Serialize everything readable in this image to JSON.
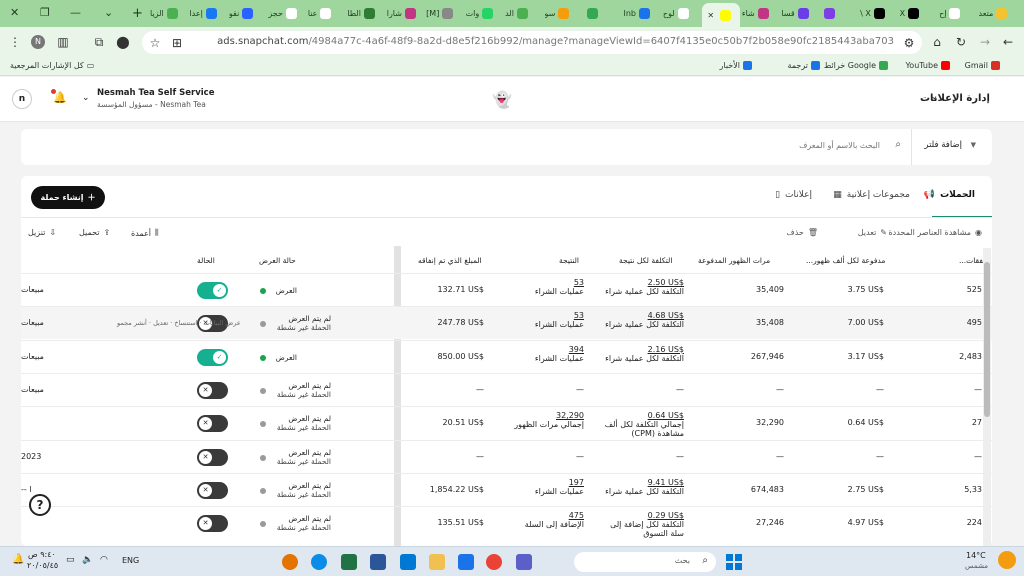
{
  "browser": {
    "tabs": [
      {
        "label": "متعد",
        "color": "#f4c430"
      },
      {
        "label": "إح",
        "color": "#ffffff"
      },
      {
        "label": "X",
        "color": "#000000"
      },
      {
        "label": "\\ X",
        "color": "#000000"
      },
      {
        "label": "",
        "color": "#7b3fe4"
      },
      {
        "label": "قسا",
        "color": "#6a3de8"
      },
      {
        "label": "شاء",
        "color": "#c13584"
      },
      {
        "label": "",
        "color": "#fffc00"
      },
      {
        "label": "لوح",
        "color": "#ffffff"
      },
      {
        "label": "Inb",
        "color": "#1a73e8"
      },
      {
        "label": "",
        "color": "#34a853"
      },
      {
        "label": "سو",
        "color": "#f59e0b"
      },
      {
        "label": "الد",
        "color": "#4caf50"
      },
      {
        "label": "وات",
        "color": "#25d366"
      },
      {
        "label": "[M]",
        "color": "#888888"
      },
      {
        "label": "شارا",
        "color": "#c13584"
      },
      {
        "label": "الطا",
        "color": "#2e7d32"
      },
      {
        "label": "عنا",
        "color": "#ffffff"
      },
      {
        "label": "حجز",
        "color": "#ffffff"
      },
      {
        "label": "نقو",
        "color": "#2962ff"
      },
      {
        "label": "إعدا",
        "color": "#1877f2"
      },
      {
        "label": "الزيا",
        "color": "#4caf50"
      }
    ],
    "url_host": "ads.snapchat.com",
    "url_path": "/4984a77c-4a6f-48f9-8a2d-d8e5f216b992/manage?manageViewId=6407f4135e0c50b7f2b058e90fc2185443aba703",
    "profile_initial": "N",
    "bookmarks": [
      {
        "label": "Gmail",
        "color": "#d93025"
      },
      {
        "label": "YouTube",
        "color": "#ff0000"
      },
      {
        "label": "خرائط Google",
        "color": "#34a853"
      },
      {
        "label": "ترجمة",
        "color": "#1a73e8"
      },
      {
        "label": "الأخبار",
        "color": "#1a73e8"
      }
    ],
    "all_bookmarks": "كل الإشارات المرجعية"
  },
  "app": {
    "title": "إدارة الإعلانات",
    "account_name": "Nesmah Tea Self Service",
    "account_role": "مسؤول المؤسسة - Nesmah Tea",
    "user_initial": "n"
  },
  "filter": {
    "add_filter": "إضافة فلتر",
    "search_placeholder": "البحث بالاسم أو المعرف"
  },
  "tabs": {
    "campaigns": "الحملات",
    "ad_groups": "مجموعات إعلانية",
    "ads": "إعلانات"
  },
  "create_campaign": "إنشاء حملة",
  "toolbar": {
    "view_selected": "مشاهدة العناصر المحددة",
    "edit": "تعديل",
    "delete": "حذف",
    "columns": "أعمدة",
    "upload": "تحميل",
    "download": "تنزيل"
  },
  "columns": {
    "spend_type": "...نفقات",
    "cpm": "...مدفوعة لكل ألف ظهور",
    "paid_impressions": "مرات الظهور المدفوعة",
    "cost_per_result": "التكلفة لكل نتيجة",
    "result": "النتيجة",
    "amount_spent": "المبلغ الذي تم إنفاقه",
    "delivery_status": "حالة العرض",
    "status": "الحالة"
  },
  "row_actions": {
    "view_data": "عرض البيانات",
    "duplicate": "استنساخ",
    "edit": "تعديل",
    "more": "أنشر مجمو"
  },
  "rows": [
    {
      "name": "مبيعات",
      "spend": "525",
      "cpm": "3.75 US$",
      "impressions": "35,409",
      "cpr_value": "2.50 US$",
      "cpr_label": "التكلفة لكل عملية شراء",
      "cpr_label2": "",
      "result_value": "53",
      "result_label": "عمليات الشراء",
      "amount": "132.71 US$",
      "delivery_1": "العرض",
      "delivery_2": "",
      "delivery_color": "#1aa34a",
      "on": true
    },
    {
      "name": "مبيعات",
      "spend": "495",
      "cpm": "7.00 US$",
      "impressions": "35,408",
      "cpr_value": "4.68 US$",
      "cpr_label": "التكلفة لكل عملية شراء",
      "cpr_label2": "",
      "result_value": "53",
      "result_label": "عمليات الشراء",
      "amount": "247.78 US$",
      "delivery_1": "لم يتم العرض",
      "delivery_2": "الحملة غير نشطة",
      "delivery_color": "#9a9a9a",
      "on": false
    },
    {
      "name": "مبيعات",
      "spend": "2,483",
      "cpm": "3.17 US$",
      "impressions": "267,946",
      "cpr_value": "2.16 US$",
      "cpr_label": "التكلفة لكل عملية شراء",
      "cpr_label2": "",
      "result_value": "394",
      "result_label": "عمليات الشراء",
      "amount": "850.00 US$",
      "delivery_1": "العرض",
      "delivery_2": "",
      "delivery_color": "#1aa34a",
      "on": true
    },
    {
      "name": "مبيعات",
      "spend": "—",
      "cpm": "—",
      "impressions": "—",
      "cpr_value": "—",
      "cpr_label": "",
      "cpr_label2": "",
      "result_value": "—",
      "result_label": "",
      "amount": "—",
      "delivery_1": "لم يتم العرض",
      "delivery_2": "الحملة غير نشطة",
      "delivery_color": "#9a9a9a",
      "on": false
    },
    {
      "name": "",
      "spend": "27",
      "cpm": "0.64 US$",
      "impressions": "32,290",
      "cpr_value": "0.64 US$",
      "cpr_label": "إجمالي التكلفة لكل ألف",
      "cpr_label2": "(CPM) مشاهدة",
      "result_value": "32,290",
      "result_label": "إجمالي مرات الظهور",
      "amount": "20.51 US$",
      "delivery_1": "لم يتم العرض",
      "delivery_2": "الحملة غير نشطة",
      "delivery_color": "#9a9a9a",
      "on": false
    },
    {
      "name": "2023",
      "spend": "—",
      "cpm": "—",
      "impressions": "—",
      "cpr_value": "—",
      "cpr_label": "",
      "cpr_label2": "",
      "result_value": "—",
      "result_label": "",
      "amount": "—",
      "delivery_1": "لم يتم العرض",
      "delivery_2": "الحملة غير نشطة",
      "delivery_color": "#9a9a9a",
      "on": false
    },
    {
      "name": "-- ا",
      "spend": "5,33",
      "cpm": "2.75 US$",
      "impressions": "674,483",
      "cpr_value": "9.41 US$",
      "cpr_label": "التكلفة لكل عملية شراء",
      "cpr_label2": "",
      "result_value": "197",
      "result_label": "عمليات الشراء",
      "amount": "1,854.22 US$",
      "delivery_1": "لم يتم العرض",
      "delivery_2": "الحملة غير نشطة",
      "delivery_color": "#9a9a9a",
      "on": false
    },
    {
      "name": "",
      "spend": "224",
      "cpm": "4.97 US$",
      "impressions": "27,246",
      "cpr_value": "0.29 US$",
      "cpr_label": "التكلفة لكل إضافة إلى",
      "cpr_label2": "سلة التسوق",
      "result_value": "475",
      "result_label": "الإضافة إلى السلة",
      "amount": "135.51 US$",
      "delivery_1": "لم يتم العرض",
      "delivery_2": "الحملة غير نشطة",
      "delivery_color": "#9a9a9a",
      "on": false
    }
  ],
  "taskbar": {
    "weather_temp": "14°C",
    "weather_desc": "مشمس",
    "search_placeholder": "بحث",
    "lang": "ENG",
    "time": "٩:٤٠ ص",
    "date": "٢٠/٠٥/٤٥"
  },
  "colors": {
    "accent": "#14b08f",
    "tabbar": "#9ed69e"
  }
}
